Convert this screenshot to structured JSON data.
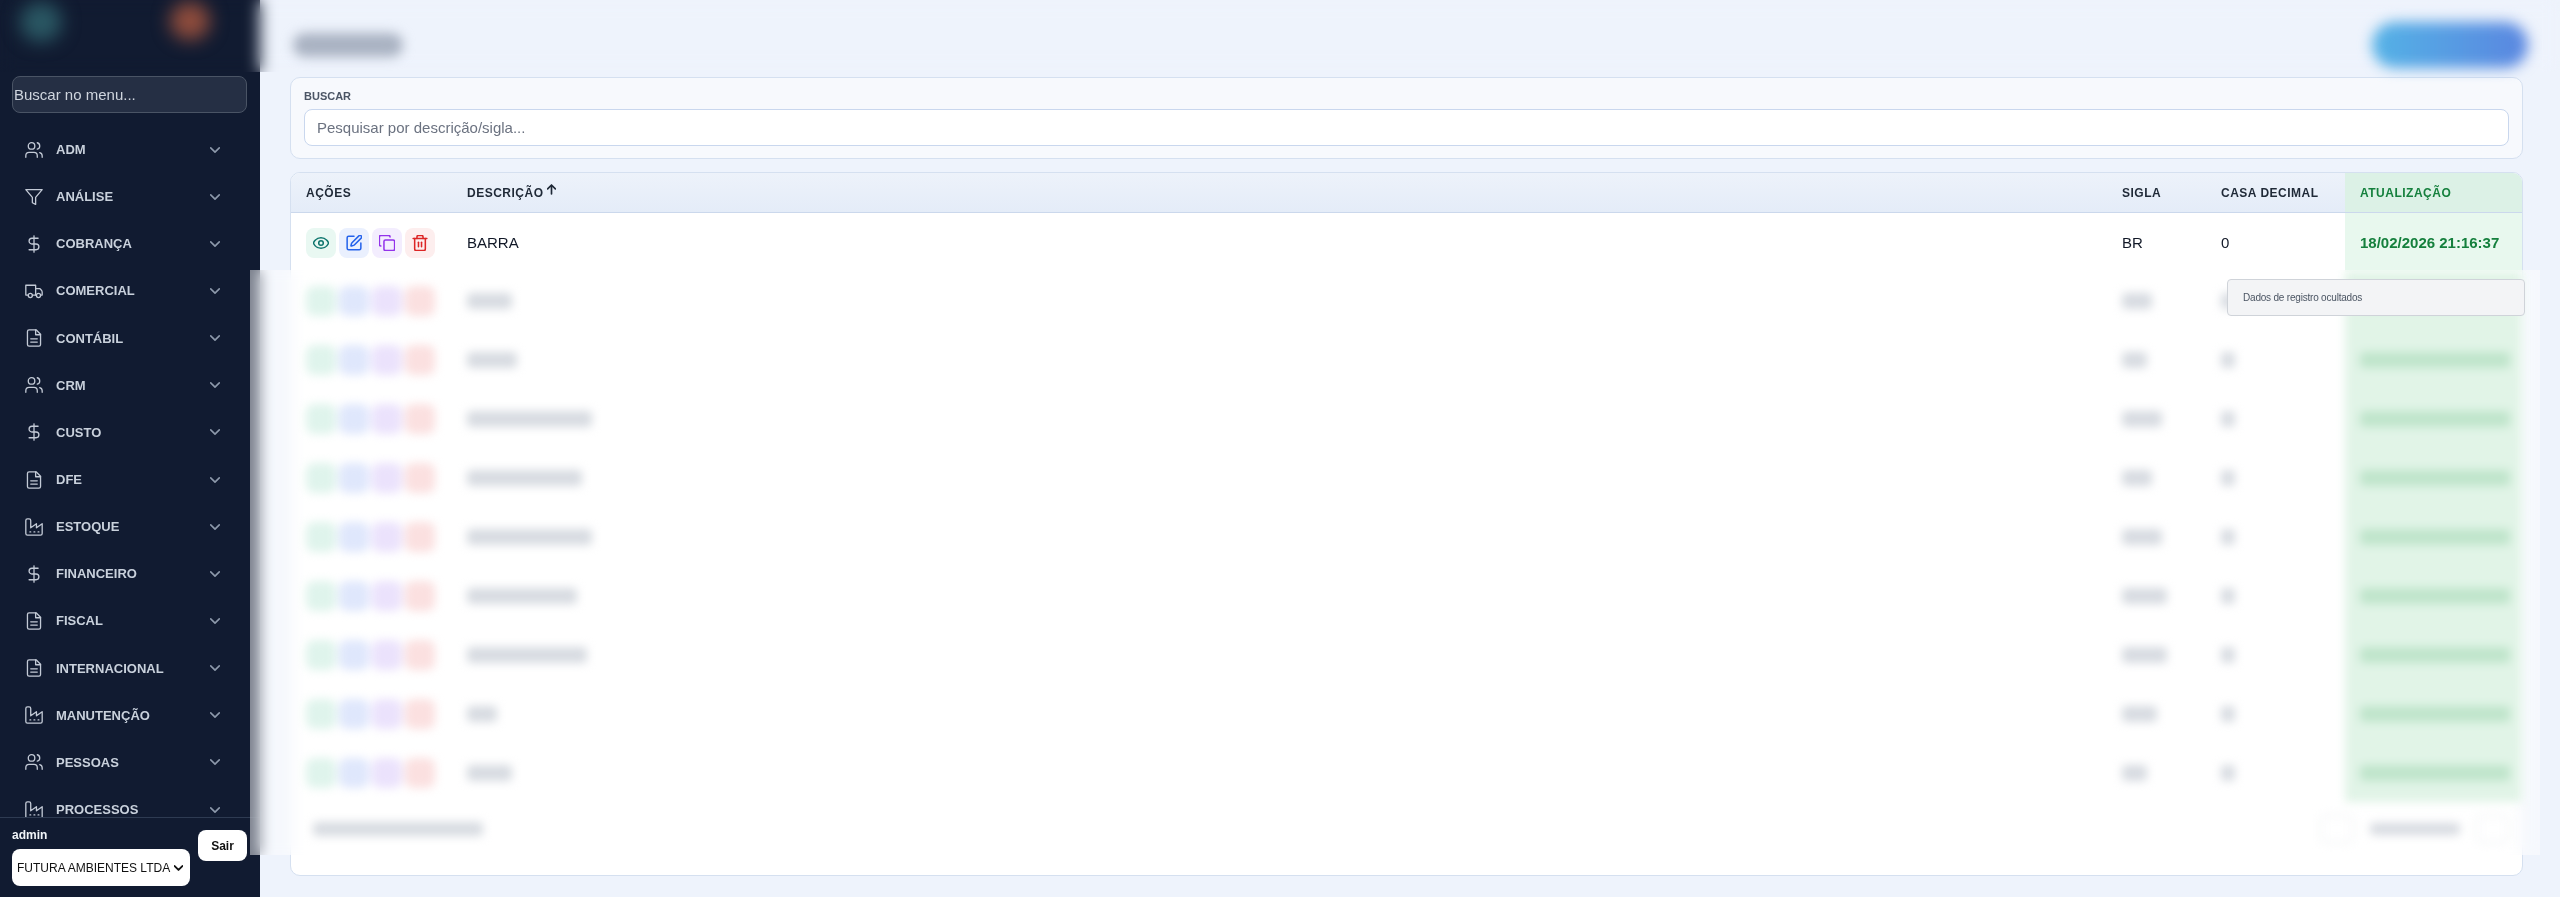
{
  "sidebar": {
    "search": {
      "placeholder": "Buscar no menu..."
    },
    "items": [
      {
        "label": "ADM",
        "kind": "users",
        "expanded": false
      },
      {
        "label": "ANÁLISE",
        "kind": "filter",
        "expanded": false
      },
      {
        "label": "COBRANÇA",
        "kind": "dollar",
        "expanded": false
      },
      {
        "label": "COMERCIAL",
        "kind": "truck",
        "expanded": false
      },
      {
        "label": "CONTÁBIL",
        "kind": "document",
        "expanded": false
      },
      {
        "label": "CRM",
        "kind": "users",
        "expanded": false
      },
      {
        "label": "CUSTO",
        "kind": "dollar",
        "expanded": false
      },
      {
        "label": "DFE",
        "kind": "document",
        "expanded": false
      },
      {
        "label": "ESTOQUE",
        "kind": "factory",
        "expanded": false
      },
      {
        "label": "FINANCEIRO",
        "kind": "dollar",
        "expanded": false
      },
      {
        "label": "FISCAL",
        "kind": "document",
        "expanded": false
      },
      {
        "label": "INTERNACIONAL",
        "kind": "document",
        "expanded": false
      },
      {
        "label": "MANUTENÇÃO",
        "kind": "factory",
        "expanded": false
      },
      {
        "label": "PESSOAS",
        "kind": "users",
        "expanded": false
      },
      {
        "label": "PROCESSOS",
        "kind": "factory",
        "expanded": false
      }
    ],
    "footer": {
      "user": "admin",
      "company": "FUTURA AMBIENTES LTDA",
      "logout": "Sair"
    }
  },
  "search": {
    "label": "BUSCAR",
    "placeholder": "Pesquisar por descrição/sigla..."
  },
  "table": {
    "columns": [
      {
        "label": "AÇÕES",
        "sorted": false,
        "highlighted": false
      },
      {
        "label": "DESCRIÇÃO",
        "sorted": true,
        "highlighted": false
      },
      {
        "label": "SIGLA",
        "sorted": false,
        "highlighted": false
      },
      {
        "label": "CASA DECIMAL",
        "sorted": false,
        "highlighted": false
      },
      {
        "label": "ATUALIZAÇÃO",
        "sorted": false,
        "highlighted": true
      }
    ],
    "rows": [
      {
        "description": "BARRA",
        "sigla": "BR",
        "decimal_places": "0",
        "updated": "18/02/2026 21:16:37"
      }
    ]
  },
  "redaction_notice": "Dados de registro ocultados"
}
